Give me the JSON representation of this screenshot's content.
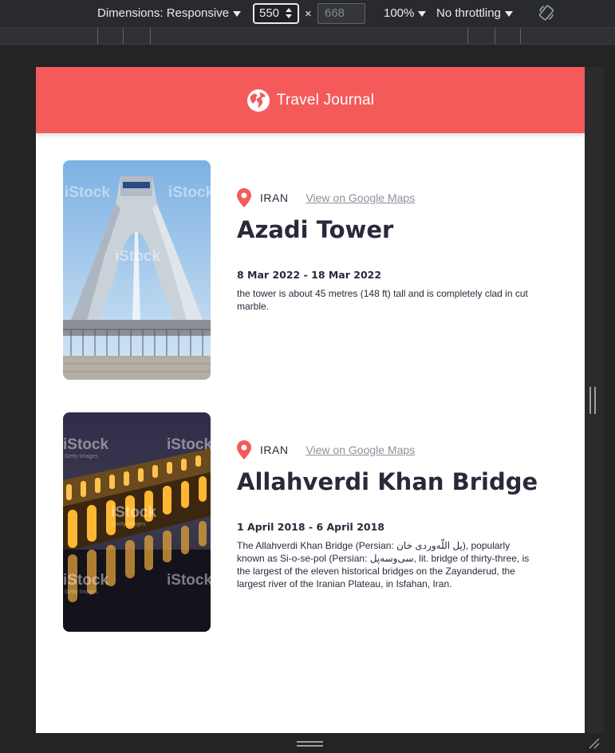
{
  "devtools": {
    "dimensions_label": "Dimensions: Responsive",
    "width_value": "550",
    "times": "×",
    "height_placeholder": "668",
    "zoom": "100%",
    "throttling": "No throttling"
  },
  "app": {
    "title": "Travel Journal"
  },
  "entries": [
    {
      "country": "IRAN",
      "maps_link": "View on Google Maps",
      "place": "Azadi Tower",
      "dates": "8 Mar 2022 - 18 Mar 2022",
      "description": "the tower is about 45 metres (148 ft) tall and is completely clad in cut marble."
    },
    {
      "country": "IRAN",
      "maps_link": "View on Google Maps",
      "place": "Allahverdi Khan Bridge",
      "dates": "1 April 2018 - 6 April 2018",
      "description": "The Allahverdi Khan Bridge (Persian: پل اللّه‌وردی خان), popularly known as Si-o-se-pol (Persian: سی‌وسه‌پل, lit. bridge of thirty-three, is the largest of the eleven historical bridges on the Zayanderud, the largest river of the Iranian Plateau, in Isfahan, Iran."
    }
  ],
  "watermark": {
    "brand": "iStock",
    "sub": "Getty Images"
  },
  "colors": {
    "header": "#f55a5a",
    "pin": "#f55a5a",
    "text": "#2b283a",
    "link": "#918e9b"
  }
}
